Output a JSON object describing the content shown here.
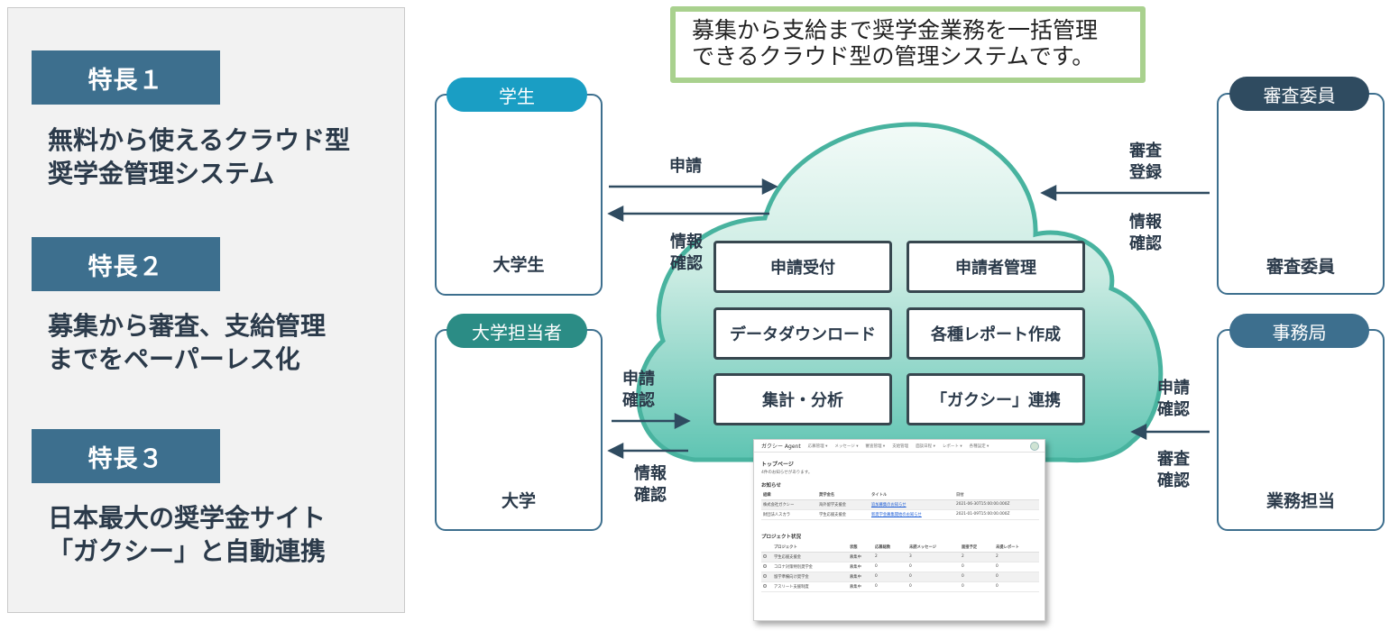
{
  "features": [
    {
      "badge": "特長１",
      "text": "無料から使えるクラウド型\n奨学金管理システム"
    },
    {
      "badge": "特長２",
      "text": "募集から審査、支給管理\nまでをペーパーレス化"
    },
    {
      "badge": "特長３",
      "text": "日本最大の奨学金サイト\n「ガクシー」と自動連携"
    }
  ],
  "headline": "募集から支給まで奨学金業務を一括管理\nできるクラウド型の管理システムです。",
  "actors": {
    "student": {
      "pill": "学生",
      "label": "大学生"
    },
    "university": {
      "pill": "大学担当者",
      "label": "大学"
    },
    "reviewer": {
      "pill": "審査委員",
      "label": "審査委員"
    },
    "office": {
      "pill": "事務局",
      "label": "業務担当"
    }
  },
  "flows": {
    "student_out": "申請",
    "student_in": "情報\n確認",
    "university_out": "申請\n確認",
    "university_in": "情報\n確認",
    "reviewer_out": "審査\n登録",
    "reviewer_in": "情報\n確認",
    "office_1": "申請\n確認",
    "office_2": "審査\n確認"
  },
  "functions": [
    "申請受付",
    "申請者管理",
    "データダウンロード",
    "各種レポート作成",
    "集計・分析",
    "「ガクシー」連携"
  ],
  "screenshot": {
    "brand": "ガクシー Agent",
    "nav": [
      "応募管理 ▾",
      "メッセージ ▾",
      "審査管理 ▾",
      "支給管理",
      "面談日程 ▾",
      "レポート ▾",
      "各種設定 ▾"
    ],
    "page_title": "トップページ",
    "notice_sub": "4件のお知らせがあります。",
    "notice_heading": "お知らせ",
    "notice_headers": [
      "組織",
      "奨学金名",
      "タイトル",
      "日付"
    ],
    "notices": [
      [
        "株式会社ガクシー",
        "海外留学支援金",
        "追加募集のお知らせ",
        "2021-06-30T15:00:00.000Z"
      ],
      [
        "財団法人スカラ",
        "学生応援支援金",
        "新奨学金募集開始のお知らせ",
        "2021-01-09T15:00:00.000Z"
      ]
    ],
    "project_heading": "プロジェクト状況",
    "project_headers": [
      "プロジェクト",
      "状態",
      "応募総数",
      "未読メッセージ",
      "面接予定",
      "未提レポート"
    ],
    "projects": [
      [
        "学生応援支援金",
        "募集中",
        "2",
        "3",
        "2",
        "2"
      ],
      [
        "コロナ対策特別奨学金",
        "募集中",
        "0",
        "0",
        "0",
        "0"
      ],
      [
        "留学準備向け奨学金",
        "募集中",
        "0",
        "0",
        "0",
        "0"
      ],
      [
        "アスリート支援制度",
        "募集中",
        "0",
        "0",
        "0",
        "0"
      ]
    ]
  },
  "colors": {
    "badge": "#3d6f8e",
    "cloud_top": "#f3fbf8",
    "cloud_bottom": "#5ec4b2",
    "headline_border": "#a9d18e"
  }
}
